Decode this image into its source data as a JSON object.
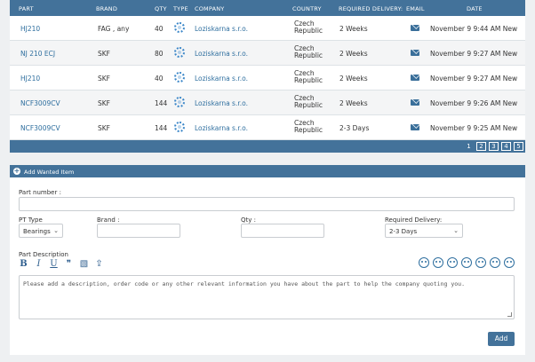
{
  "table": {
    "columns": [
      "PART",
      "BRAND",
      "QTY",
      "TYPE",
      "COMPANY",
      "COUNTRY",
      "REQUIRED DELIVERY:",
      "EMAIL",
      "DATE"
    ],
    "rows": [
      {
        "part": "HJ210",
        "brand": "FAG , any",
        "qty": "40",
        "company": "Loziskarna s.r.o.",
        "country_1": "Czech",
        "country_2": "Republic",
        "delivery": "2 Weeks",
        "date": "November 9 9:44 AM New"
      },
      {
        "part": "NJ 210 ECJ",
        "brand": "SKF",
        "qty": "80",
        "company": "Loziskarna s.r.o.",
        "country_1": "Czech",
        "country_2": "Republic",
        "delivery": "2 Weeks",
        "date": "November 9 9:27 AM New"
      },
      {
        "part": "HJ210",
        "brand": "SKF",
        "qty": "40",
        "company": "Loziskarna s.r.o.",
        "country_1": "Czech",
        "country_2": "Republic",
        "delivery": "2 Weeks",
        "date": "November 9 9:27 AM New"
      },
      {
        "part": "NCF3009CV",
        "brand": "SKF",
        "qty": "144",
        "company": "Loziskarna s.r.o.",
        "country_1": "Czech",
        "country_2": "Republic",
        "delivery": "2 Weeks",
        "date": "November 9 9:26 AM New"
      },
      {
        "part": "NCF3009CV",
        "brand": "SKF",
        "qty": "144",
        "company": "Loziskarna s.r.o.",
        "country_1": "Czech",
        "country_2": "Republic",
        "delivery": "2-3 Days",
        "date": "November 9 9:25 AM New"
      }
    ],
    "pages": [
      "1",
      "2",
      "3",
      "4",
      "5"
    ]
  },
  "form": {
    "title": "Add Wanted Item",
    "part_number_label": "Part number :",
    "part_number_value": "",
    "pt_type_label": "PT Type",
    "pt_type_value": "Bearings",
    "brand_label": "Brand :",
    "brand_value": "",
    "qty_label": "Qty :",
    "qty_value": "",
    "delivery_label": "Required Delivery:",
    "delivery_value": "2-3 Days",
    "description_label": "Part Description",
    "description_placeholder": "Please add a description, order code or any other relevant information you have about the part to help the company quoting you.",
    "toolbar": {
      "bold": "B",
      "italic": "I",
      "underline": "U",
      "quote": "❞",
      "image": "▧",
      "upload": "⇪"
    },
    "add_button": "Add"
  },
  "colors": {
    "header": "#43729a",
    "link": "#2f6f9f"
  }
}
